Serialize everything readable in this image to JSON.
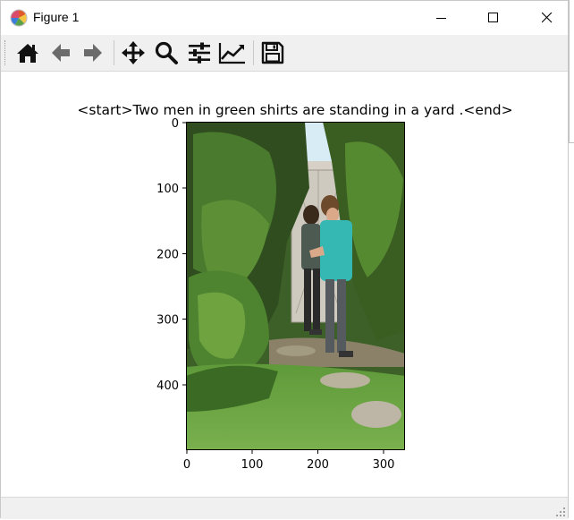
{
  "window": {
    "title": "Figure 1",
    "icons": {
      "app": "matplotlib-app-icon",
      "minimize": "minimize-icon",
      "maximize": "maximize-icon",
      "close": "close-icon"
    }
  },
  "toolbar": {
    "buttons": [
      {
        "name": "home",
        "icon": "home-icon"
      },
      {
        "name": "back",
        "icon": "arrow-left-icon"
      },
      {
        "name": "forward",
        "icon": "arrow-right-icon"
      },
      {
        "name": "pan",
        "icon": "move-arrows-icon"
      },
      {
        "name": "zoom",
        "icon": "magnifier-icon"
      },
      {
        "name": "configure-subplots",
        "icon": "sliders-icon"
      },
      {
        "name": "edit-axes",
        "icon": "line-chart-icon"
      },
      {
        "name": "save",
        "icon": "floppy-disk-icon"
      }
    ]
  },
  "figure": {
    "title": "<start>Two men in green shirts are standing in a yard .<end>",
    "image_description_hidden": false
  },
  "chart_data": {
    "type": "image",
    "title": "<start>Two men in green shirts are standing in a yard .<end>",
    "xticks": [
      "0",
      "100",
      "200",
      "300"
    ],
    "yticks": [
      "0",
      "100",
      "200",
      "300",
      "400"
    ],
    "x_values": [
      0,
      100,
      200,
      300
    ],
    "y_values": [
      0,
      100,
      200,
      300,
      400
    ],
    "xlim": [
      0,
      333
    ],
    "ylim": [
      500,
      0
    ]
  },
  "colors": {
    "toolbar_bg": "#f0f0f0",
    "icon_dark": "#111111",
    "icon_disabled": "#6b6b6b"
  }
}
